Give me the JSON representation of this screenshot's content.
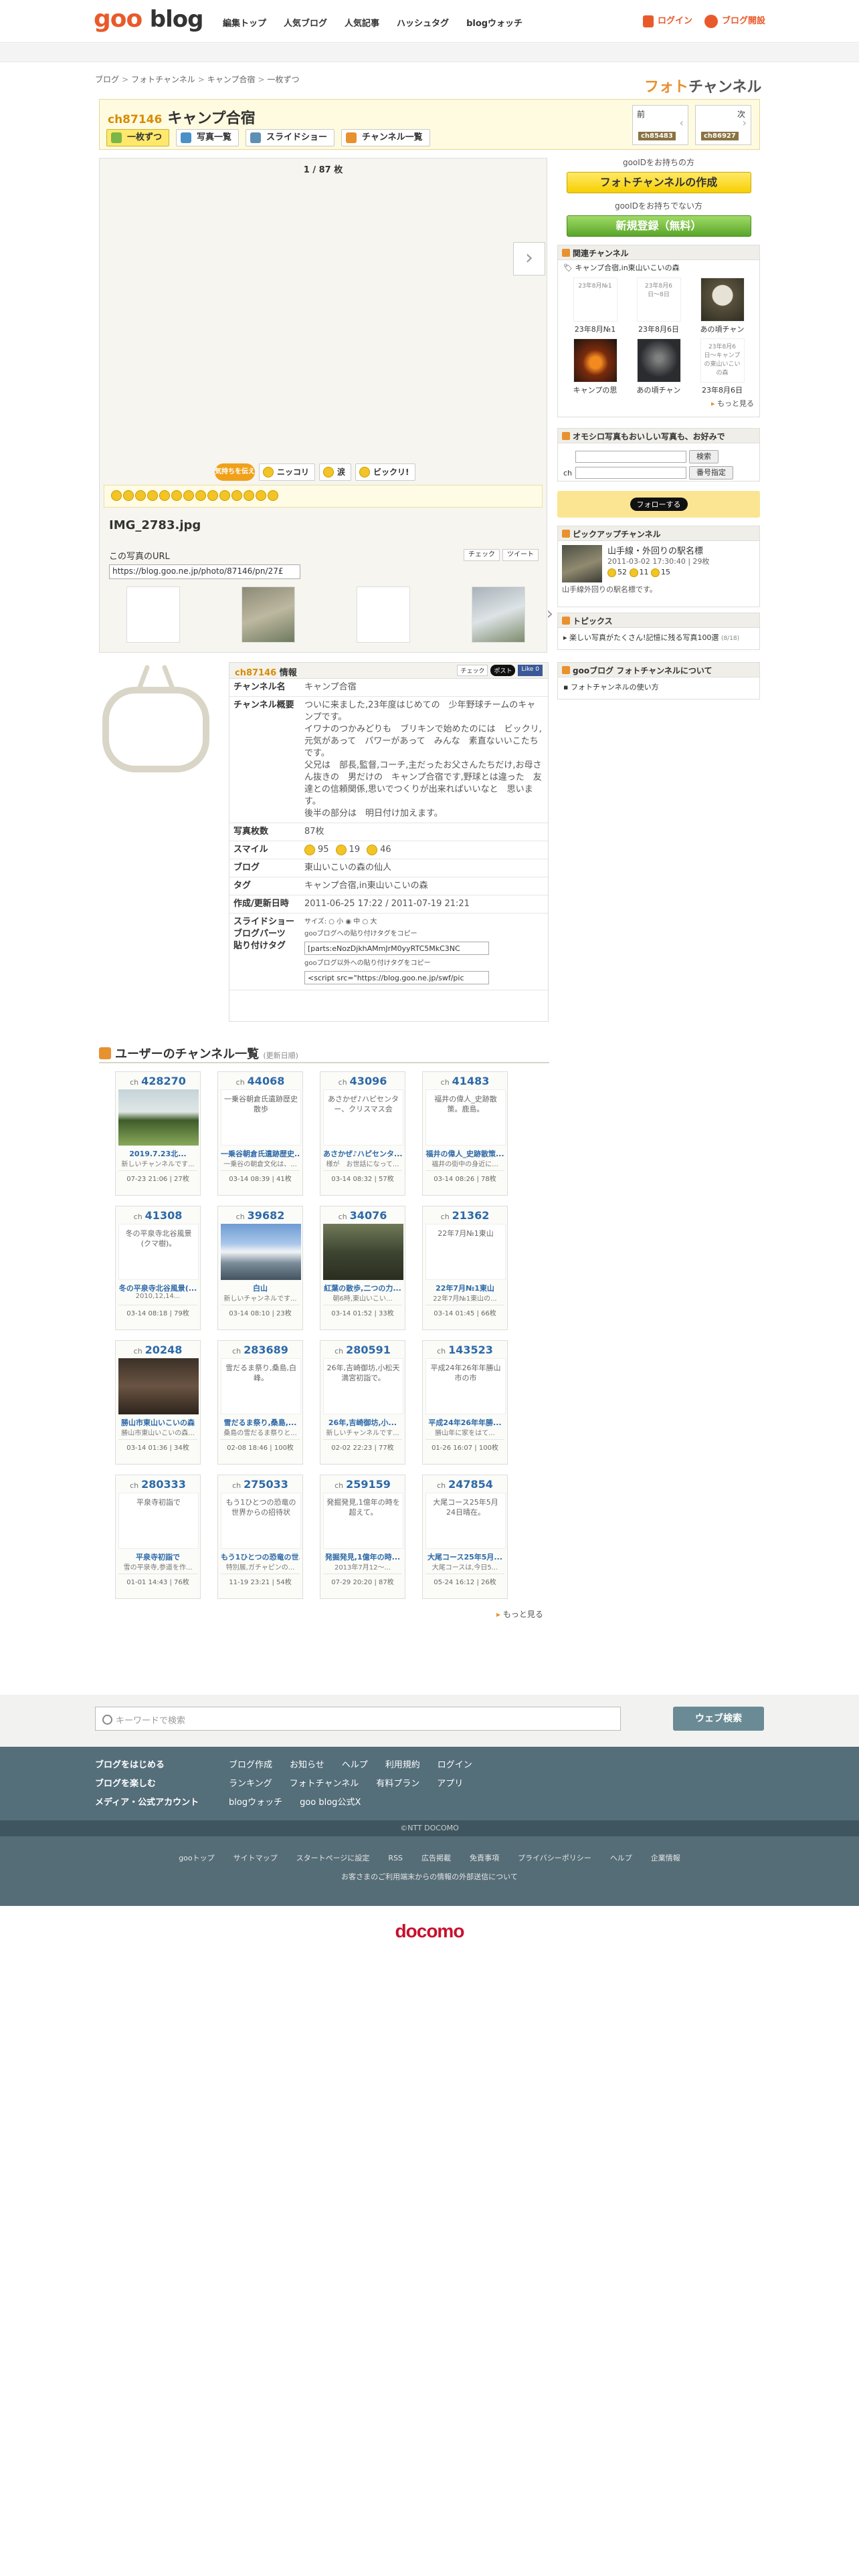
{
  "header": {
    "logo_goo": "goo",
    "logo_blog": "blog",
    "nav": [
      "編集トップ",
      "人気ブログ",
      "人気記事",
      "ハッシュタグ",
      "blogウォッチ"
    ],
    "login": "ログイン",
    "register": "ブログ開設"
  },
  "breadcrumb": [
    "ブログ",
    "フォトチャンネル",
    "キャンプ合宿",
    "一枚ずつ"
  ],
  "photochannel_logo": {
    "a": "フォト",
    "b": "チャンネル"
  },
  "channel": {
    "id": "ch87146",
    "title": "キャンプ合宿",
    "tabs": [
      "一枚ずつ",
      "写真一覧",
      "スライドショー",
      "チャンネル一覧"
    ],
    "prev": {
      "label": "前",
      "badge": "ch85483"
    },
    "next": {
      "label": "次",
      "badge": "ch86927"
    }
  },
  "viewer": {
    "counter": "1 / 87 枚",
    "mood_badge": "気持ちを伝えよう",
    "mood_buttons": [
      "ニッコリ",
      "涙",
      "ビックリ!"
    ],
    "image_name": "IMG_2783.jpg",
    "url_label": "この写真のURL",
    "url_value": "https://blog.goo.ne.jp/photo/87146/pn/27£",
    "share_check": "チェック",
    "share_tweet": "ツイート"
  },
  "sidebar": {
    "intro1": "gooIDをお持ちの方",
    "create_btn": "フォトチャンネルの作成",
    "intro2": "gooIDをお持ちでない方",
    "signup_btn": "新規登録（無料）",
    "related_title": "関連チャンネル",
    "related_sub": "キャンプ合宿,in東山いこいの森",
    "related": [
      {
        "img": "23年8月№1",
        "caption": "23年8月№1",
        "style": ""
      },
      {
        "img": "23年8月6日〜8日",
        "caption": "23年8月6日",
        "style": ""
      },
      {
        "img": "",
        "caption": "あの頃チャン",
        "style": "mush"
      },
      {
        "img": "",
        "caption": "キャンプの思",
        "style": "fire"
      },
      {
        "img": "",
        "caption": "あの頃チャン",
        "style": "dark"
      },
      {
        "img": "23年8月6日〜キャンプの東山いこいの森",
        "caption": "23年8月6日",
        "style": ""
      }
    ],
    "related_more": "もっと見る",
    "search_title": "オモシロ写真もおいしい写真も、お好みで",
    "search_btn": "検索",
    "ch_label": "ch",
    "number_btn": "番号指定",
    "follow": "フォローする",
    "pickup_title": "ピックアップチャンネル",
    "pickup_name": "山手線・外回りの駅名標",
    "pickup_date": "2011-03-02 17:30:40 | 29枚",
    "pickup_m1": "52",
    "pickup_m2": "11",
    "pickup_m3": "15",
    "pickup_caption": "山手線外回りの駅名標です。",
    "topics_title": "トピックス",
    "topic": "楽しい写真がたくさん!記憶に残る写真100選",
    "topic_count": "(8/18)",
    "about_title": "gooブログ フォトチャンネルについて",
    "about_link": "フォトチャンネルの使い方"
  },
  "info": {
    "head": "情報",
    "head_ch": "ch87146",
    "share": [
      "チェック",
      "ポスト",
      "Like 0"
    ],
    "rows": [
      {
        "k": "チャンネル名",
        "v": "キャンプ合宿"
      },
      {
        "k": "チャンネル概要",
        "v": "ついに来ました,23年度はじめての　少年野球チームのキャンプです。\nイワナのつかみどりも　ブリキンで始めたのには　ビックリ,元気があって　パワーがあって　みんな　素直ないいこたちです。\n父兄は　部長,監督,コーチ,主だったお父さんたちだけ,お母さん抜きの　男だけの　キャンプ合宿です,野球とは違った　友達との信頼関係,思いでつくりが出来ればいいなと　思います。\n後半の部分は　明日付け加えます。"
      },
      {
        "k": "写真枚数",
        "v": "87枚"
      },
      {
        "k": "スマイル",
        "v": ""
      },
      {
        "k": "ブログ",
        "v": "東山いこいの森の仙人"
      },
      {
        "k": "タグ",
        "v": "キャンプ合宿,in東山いこいの森"
      },
      {
        "k": "作成/更新日時",
        "v": "2011-06-25 17:22 / 2011-07-19 21:21"
      },
      {
        "k": "スライドショー\nブログパーツ\n貼り付けタグ",
        "v": ""
      }
    ],
    "smile": [
      "95",
      "19",
      "46"
    ],
    "size_label": "サイズ:",
    "sizes": [
      "小",
      "中",
      "大"
    ],
    "tag_note1": "gooブログへの貼り付けタグをコピー",
    "tag_val1": "[parts:eNozDjkhAMmJrM0yyRTC5MkC3NC",
    "tag_note2": "gooブログ以外への貼り付けタグをコピー",
    "tag_val2": "<script src=\"https://blog.goo.ne.jp/swf/pic"
  },
  "user_channels": {
    "title": "ユーザーのチャンネル一覧",
    "sub": "(更新日順)",
    "more": "もっと見る",
    "cards": [
      {
        "ch": "428270",
        "img": "",
        "p": "a",
        "title": "2019.7.23北...",
        "desc": "新しいチャンネルです...",
        "foot": "07-23 21:06 | 27枚"
      },
      {
        "ch": "44068",
        "img": "一乗谷朝倉氏遺跡歴史散歩",
        "p": "",
        "title": "一乗谷朝倉氏遺跡歴史...",
        "desc": "一乗谷の朝倉文化は、...",
        "foot": "03-14 08:39 | 41枚"
      },
      {
        "ch": "43096",
        "img": "あさかぜ♪ハピセンター、クリスマス会",
        "p": "",
        "title": "あさかぜ♪ハピセンタ...",
        "desc": "様が　お世話になって...",
        "foot": "03-14 08:32 | 57枚"
      },
      {
        "ch": "41483",
        "img": "福井の偉人_史跡散策。鹿島。",
        "p": "",
        "title": "福井の偉人_史跡散策...",
        "desc": "福井の街中の身近に...",
        "foot": "03-14 08:26 | 78枚"
      },
      {
        "ch": "41308",
        "img": "冬の平泉寺北谷風景(クマ樹)。",
        "p": "",
        "title": "冬の平泉寺北谷風景(...",
        "desc": "2010,12,14...",
        "foot": "03-14 08:18 | 79枚"
      },
      {
        "ch": "39682",
        "img": "",
        "p": "b",
        "title": "白山",
        "desc": "新しいチャンネルです...",
        "foot": "03-14 08:10 | 23枚"
      },
      {
        "ch": "34076",
        "img": "",
        "p": "c",
        "title": "紅葉の散歩,二つの力...",
        "desc": "朝6時,東山いこい...",
        "foot": "03-14 01:52 | 33枚"
      },
      {
        "ch": "21362",
        "img": "22年7月№1東山",
        "p": "",
        "title": "22年7月№1東山",
        "desc": "22年7月№1東山の...",
        "foot": "03-14 01:45 | 66枚"
      },
      {
        "ch": "20248",
        "img": "",
        "p": "d",
        "title": "勝山市東山いこいの森",
        "desc": "勝山市東山いこいの森...",
        "foot": "03-14 01:36 | 34枚"
      },
      {
        "ch": "283689",
        "img": "雪だるま祭り,桑島,白峰。",
        "p": "",
        "title": "雪だるま祭り,桑島,...",
        "desc": "桑島の雪だるま祭りと...",
        "foot": "02-08 18:46 | 100枚"
      },
      {
        "ch": "280591",
        "img": "26年,吉崎御坊,小松天満宮初詣で。",
        "p": "",
        "title": "26年,吉崎御坊,小...",
        "desc": "新しいチャンネルです...",
        "foot": "02-02 22:23 | 77枚"
      },
      {
        "ch": "143523",
        "img": "平成24年26年年勝山市の市",
        "p": "",
        "title": "平成24年26年年勝...",
        "desc": "勝山年に家をはて...",
        "foot": "01-26 16:07 | 100枚"
      },
      {
        "ch": "280333",
        "img": "平泉寺初詣で",
        "p": "",
        "title": "平泉寺初詣で",
        "desc": "雪の平泉寺,参道を作...",
        "foot": "01-01 14:43 | 76枚"
      },
      {
        "ch": "275033",
        "img": "もう1ひとつの恐竜の世界からの招待状",
        "p": "",
        "title": "もう1ひとつの恐竜の世...",
        "desc": "特別展,ガチャピンの...",
        "foot": "11-19 23:21 | 54枚"
      },
      {
        "ch": "259159",
        "img": "発掘発見,1億年の時を超えて。",
        "p": "",
        "title": "発掘発見,1億年の時...",
        "desc": "2013年7月12〜...",
        "foot": "07-29 20:20 | 87枚"
      },
      {
        "ch": "247854",
        "img": "大尾コース25年5月24日晴在。",
        "p": "",
        "title": "大尾コース25年5月...",
        "desc": "大尾コースは,今日5...",
        "foot": "05-24 16:12 | 26枚"
      }
    ]
  },
  "footer": {
    "search_placeholder": "キーワードで検索",
    "search_btn": "ウェブ検索",
    "col1": [
      "ブログをはじめる",
      "ブログを楽しむ",
      "メディア・公式アカウント"
    ],
    "row1": [
      "ブログ作成",
      "お知らせ",
      "ヘルプ",
      "利用規約",
      "ログイン"
    ],
    "row2": [
      "ランキング",
      "フォトチャンネル",
      "有料プラン",
      "アプリ"
    ],
    "row3": [
      "blogウォッチ",
      "goo blog公式X"
    ],
    "copyright": "©NTT DOCOMO",
    "sub_links": [
      "gooトップ",
      "サイトマップ",
      "スタートページに設定",
      "RSS",
      "広告掲載",
      "免責事項",
      "プライバシーポリシー",
      "ヘルプ",
      "企業情報"
    ],
    "sub_note": "お客さまのご利用端末からの情報の外部送信について",
    "docomo": "docomo"
  }
}
